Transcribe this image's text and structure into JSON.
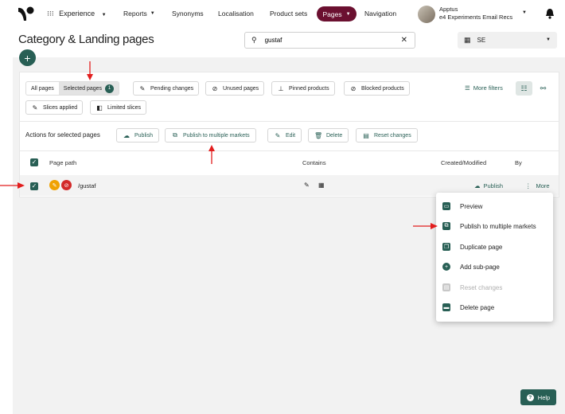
{
  "topbar": {
    "apps_label": "Experience",
    "nav": [
      "Reports",
      "Synonyms",
      "Localisation",
      "Product sets",
      "Pages",
      "Navigation"
    ],
    "user_name": "Apptus",
    "user_sub": "e4 Experiments Email Recs"
  },
  "header": {
    "title": "Category & Landing pages",
    "search_value": "gustaf",
    "market": "SE"
  },
  "filters": {
    "segments": [
      "All pages",
      "Selected pages"
    ],
    "selected_count": "1",
    "chips": [
      "Pending changes",
      "Unused pages",
      "Pinned products",
      "Blocked products"
    ],
    "more_filters": "More filters",
    "chips2": [
      "Slices applied",
      "Limited slices"
    ]
  },
  "actions": {
    "label": "Actions for selected pages",
    "buttons": [
      "Publish",
      "Publish to multiple markets",
      "Edit",
      "Delete",
      "Reset changes"
    ]
  },
  "table": {
    "headers": [
      "Page path",
      "Contains",
      "Created/Modified",
      "By"
    ],
    "row": {
      "path": "/gustaf",
      "publish": "Publish",
      "more": "More"
    }
  },
  "menu": {
    "items": [
      "Preview",
      "Publish to multiple markets",
      "Duplicate page",
      "Add sub-page",
      "Reset changes",
      "Delete page"
    ]
  },
  "help": "Help",
  "colors": {
    "accent": "#285f55",
    "pages_pill": "#6b1030",
    "annotation_arrow": "#e21e1e"
  }
}
